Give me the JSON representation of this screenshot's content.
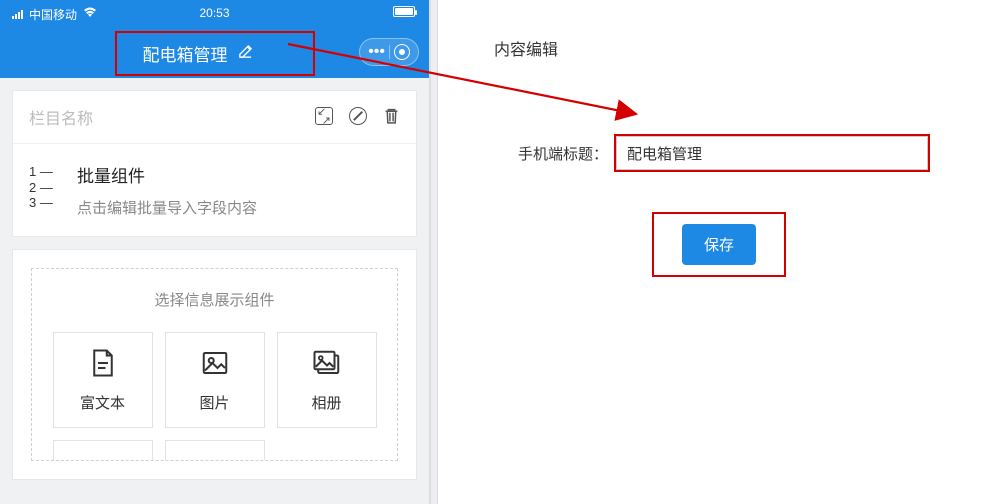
{
  "status": {
    "carrier": "中国移动",
    "time": "20:53"
  },
  "phone": {
    "title": "配电箱管理"
  },
  "column": {
    "placeholder": "栏目名称"
  },
  "batch": {
    "title": "批量组件",
    "desc": "点击编辑批量导入字段内容"
  },
  "components": {
    "heading": "选择信息展示组件",
    "items": [
      {
        "label": "富文本",
        "icon": "doc-icon"
      },
      {
        "label": "图片",
        "icon": "image-icon"
      },
      {
        "label": "相册",
        "icon": "album-icon"
      }
    ]
  },
  "editor": {
    "heading": "内容编辑",
    "field_label": "手机端标题：",
    "field_value": "配电箱管理",
    "save_label": "保存"
  },
  "colors": {
    "accent": "#1e88e5",
    "annotation": "#d40000"
  }
}
